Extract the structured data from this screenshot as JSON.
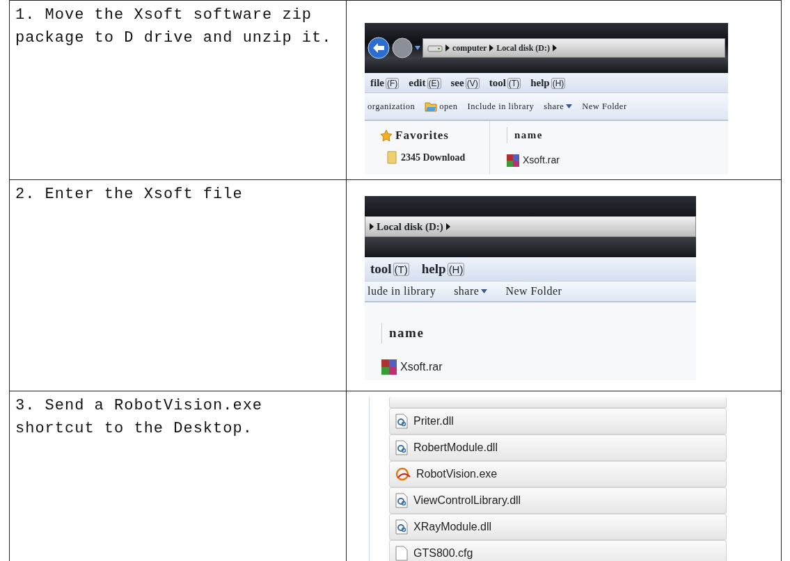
{
  "steps": [
    {
      "text": "1. Move the Xsoft software zip package to D drive and unzip it.",
      "screenshot": {
        "kind": "explorer",
        "nav_buttons": true,
        "breadcrumb": [
          "computer",
          "Local disk (D:)"
        ],
        "menu": [
          {
            "label": "file",
            "key": "(F)"
          },
          {
            "label": "edit",
            "key": "(E)"
          },
          {
            "label": "see",
            "key": "(V)"
          },
          {
            "label": "tool",
            "key": "(T)"
          },
          {
            "label": "help",
            "key": "(H)"
          }
        ],
        "toolbar": [
          {
            "label": "organization",
            "kind": "plain"
          },
          {
            "label": "open",
            "kind": "icon"
          },
          {
            "label": "Include in library",
            "kind": "plain"
          },
          {
            "label": "share",
            "kind": "dropdown"
          },
          {
            "label": "New Folder",
            "kind": "plain"
          }
        ],
        "sidebar": {
          "title": "Favorites",
          "items": [
            "2345 Download"
          ]
        },
        "column_header": "name",
        "files": [
          {
            "name": "Xsoft.rar",
            "kind": "rar"
          }
        ]
      }
    },
    {
      "text": "2. Enter the Xsoft file",
      "screenshot": {
        "kind": "explorer",
        "nav_buttons": false,
        "breadcrumb": [
          "Local disk (D:)"
        ],
        "menu": [
          {
            "label": "tool",
            "key": "(T)"
          },
          {
            "label": "help",
            "key": "(H)"
          }
        ],
        "toolbar": [
          {
            "label": "lude in library",
            "kind": "plain"
          },
          {
            "label": "share",
            "kind": "dropdown"
          },
          {
            "label": "New Folder",
            "kind": "plain"
          }
        ],
        "column_header": "name",
        "files": [
          {
            "name": "Xsoft.rar",
            "kind": "rar"
          }
        ]
      }
    },
    {
      "text": "3. Send a RobotVision.exe shortcut to the Desktop.",
      "screenshot": {
        "kind": "file_list",
        "files": [
          {
            "name": "Priter.dll",
            "kind": "dll"
          },
          {
            "name": "RobertModule.dll",
            "kind": "dll"
          },
          {
            "name": "RobotVision.exe",
            "kind": "exe"
          },
          {
            "name": "ViewControlLibrary.dll",
            "kind": "dll"
          },
          {
            "name": "XRayModule.dll",
            "kind": "dll"
          },
          {
            "name": "GTS800.cfg",
            "kind": "cfg"
          }
        ]
      }
    }
  ]
}
